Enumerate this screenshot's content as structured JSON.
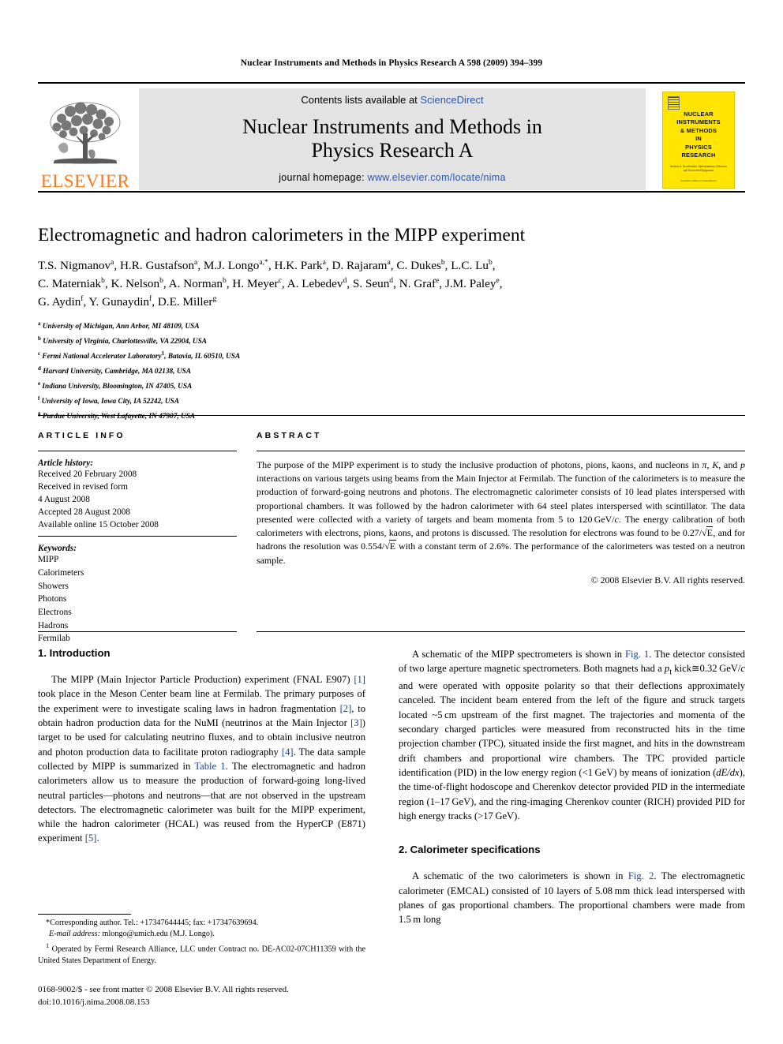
{
  "running_head": "Nuclear Instruments and Methods in Physics Research A 598 (2009) 394–399",
  "masthead": {
    "publisher_name": "ELSEVIER",
    "contents_prefix": "Contents lists available at ",
    "sciencedirect": "ScienceDirect",
    "journal_title_line1": "Nuclear Instruments and Methods in",
    "journal_title_line2": "Physics Research A",
    "homepage_prefix": "journal homepage: ",
    "homepage_url": "www.elsevier.com/locate/nima",
    "cover": {
      "title_lines": [
        "NUCLEAR",
        "INSTRUMENTS",
        "& METHODS",
        "IN",
        "PHYSICS",
        "RESEARCH"
      ],
      "subtitle": "Section A: Accelerators, Spectrometers, Detectors and Associated Equipment",
      "footer": "Available online at ScienceDirect"
    },
    "accent_orange": "#F47B20",
    "link_blue": "#2b56a8",
    "band_gray": "#e3e3e3",
    "cover_yellow": "#FFE500"
  },
  "article": {
    "title": "Electromagnetic and hadron calorimeters in the MIPP experiment",
    "authors_html": "T.S. Nigmanov<sup>a</sup>, H.R. Gustafson<sup>a</sup>, M.J. Longo<sup>a,*</sup>, H.K. Park<sup>a</sup>, D. Rajaram<sup>a</sup>, C. Dukes<sup>b</sup>, L.C. Lu<sup>b</sup>,<br>C. Materniak<sup>b</sup>, K. Nelson<sup>b</sup>, A. Norman<sup>b</sup>, H. Meyer<sup>c</sup>, A. Lebedev<sup>d</sup>, S. Seun<sup>d</sup>, N. Graf<sup>e</sup>, J.M. Paley<sup>e</sup>,<br>G. Aydin<sup>f</sup>, Y. Gunaydin<sup>f</sup>, D.E. Miller<sup>g</sup>",
    "affiliations_html": "<sup>a</sup> University of Michigan, Ann Arbor, MI 48109, USA<br><sup>b</sup> University of Virginia, Charlottesville, VA 22904, USA<br><sup>c</sup> Fermi National Accelerator Laboratory<sup>1</sup>, Batavia, IL 60510, USA<br><sup>d</sup> Harvard University, Cambridge, MA 02138, USA<br><sup>e</sup> Indiana University, Bloomington, IN 47405, USA<br><sup>f</sup> University of Iowa, Iowa City, IA 52242, USA<br><sup>g</sup> Purdue University, West Lafayette, IN 47907, USA"
  },
  "article_info": {
    "label": "ARTICLE INFO",
    "history_title": "Article history:",
    "history_lines": [
      "Received 20 February 2008",
      "Received in revised form",
      "4 August 2008",
      "Accepted 28 August 2008",
      "Available online 15 October 2008"
    ],
    "keywords_title": "Keywords:",
    "keywords": [
      "MIPP",
      "Calorimeters",
      "Showers",
      "Photons",
      "Electrons",
      "Hadrons",
      "Fermilab"
    ]
  },
  "abstract": {
    "label": "ABSTRACT",
    "body_html": "The purpose of the MIPP experiment is to study the inclusive production of photons, pions, kaons, and nucleons in <i>&#960;</i>, <i>K</i>, and <i>p</i> interactions on various targets using beams from the Main Injector at Fermilab. The function of the calorimeters is to measure the production of forward-going neutrons and photons. The electromagnetic calorimeter consists of 10 lead plates interspersed with proportional chambers. It was followed by the hadron calorimeter with 64 steel plates interspersed with scintillator. The data presented were collected with a variety of targets and beam momenta from 5 to 120&#8239;GeV/<i>c</i>. The energy calibration of both calorimeters with electrons, pions, kaons, and protons is discussed. The resolution for electrons was found to be 0.27/<span class=\"sqrt\"><span class=\"rad\">&#8730;</span><span class=\"bar\">E</span></span>, and for hadrons the resolution was 0.554/<span class=\"sqrt\"><span class=\"rad\">&#8730;</span><span class=\"bar\">E</span></span> with a constant term of 2.6%. The performance of the calorimeters was tested on a neutron sample.",
    "copyright": "© 2008 Elsevier B.V. All rights reserved."
  },
  "sections": {
    "intro_heading": "1. Introduction",
    "intro_par_html": "The MIPP (Main Injector Particle Production) experiment (FNAL E907) <span class=\"ref\">[1]</span> took place in the Meson Center beam line at Fermilab. The primary purposes of the experiment were to investigate scaling laws in hadron fragmentation <span class=\"ref\">[2]</span>, to obtain hadron production data for the NuMI (neutrinos at the Main Injector <span class=\"ref\">[3]</span>) target to be used for calculating neutrino fluxes, and to obtain inclusive neutron and photon production data to facilitate proton radiography <span class=\"ref\">[4]</span>. The data sample collected by MIPP is summarized in <span class=\"ref\">Table 1</span>. The electromagnetic and hadron calorimeters allow us to measure the production of forward-going long-lived neutral particles—photons and neutrons—that are not observed in the upstream detectors. The electromagnetic calorimeter was built for the MIPP experiment, while the hadron calorimeter (HCAL) was reused from the HyperCP (E871) experiment <span class=\"ref\">[5]</span>.",
    "right_par_html": "A schematic of the MIPP spectrometers is shown in <span class=\"ref\">Fig. 1</span>. The detector consisted of two large aperture magnetic spectrometers. Both magnets had a <i class=\"em\">p</i><sub>t</sub> kick&#8773;0.32&#8239;GeV/<i class=\"em\">c</i> and were operated with opposite polarity so that their deflections approximately canceled. The incident beam entered from the left of the figure and struck targets located ~5&#8239;cm upstream of the first magnet. The trajectories and momenta of the secondary charged particles were measured from reconstructed hits in the time projection chamber (TPC), situated inside the first magnet, and hits in the downstream drift chambers and proportional wire chambers. The TPC provided particle identification (PID) in the low energy region (&lt;1&#8239;GeV) by means of ionization (<i class=\"em\">dE/dx</i>), the time-of-flight hodoscope and Cherenkov detector provided PID in the intermediate region (1–17&#8239;GeV), and the ring-imaging Cherenkov counter (RICH) provided PID for high energy tracks (&gt;17&#8239;GeV).",
    "calo_heading": "2. Calorimeter specifications",
    "calo_par_html": "A schematic of the two calorimeters is shown in <span class=\"ref\">Fig. 2</span>. The electromagnetic calorimeter (EMCAL) consisted of 10 layers of 5.08&#8239;mm thick lead interspersed with planes of gas proportional chambers. The proportional chambers were made from 1.5&#8239;m long"
  },
  "footnotes": {
    "corresponding_html": "*Corresponding author. Tel.: +17347644445; fax: +17347639694.",
    "email_html": "<i>E-mail address:</i> mlongo@umich.edu (M.J. Longo).",
    "note1_html": "<sup>1</sup> Operated by Fermi Research Alliance, LLC under Contract no. DE-AC02-07CH11359 with the United States Department of Energy.",
    "issn_line": "0168-9002/$ - see front matter © 2008 Elsevier B.V. All rights reserved.",
    "doi_line": "doi:10.1016/j.nima.2008.08.153"
  }
}
